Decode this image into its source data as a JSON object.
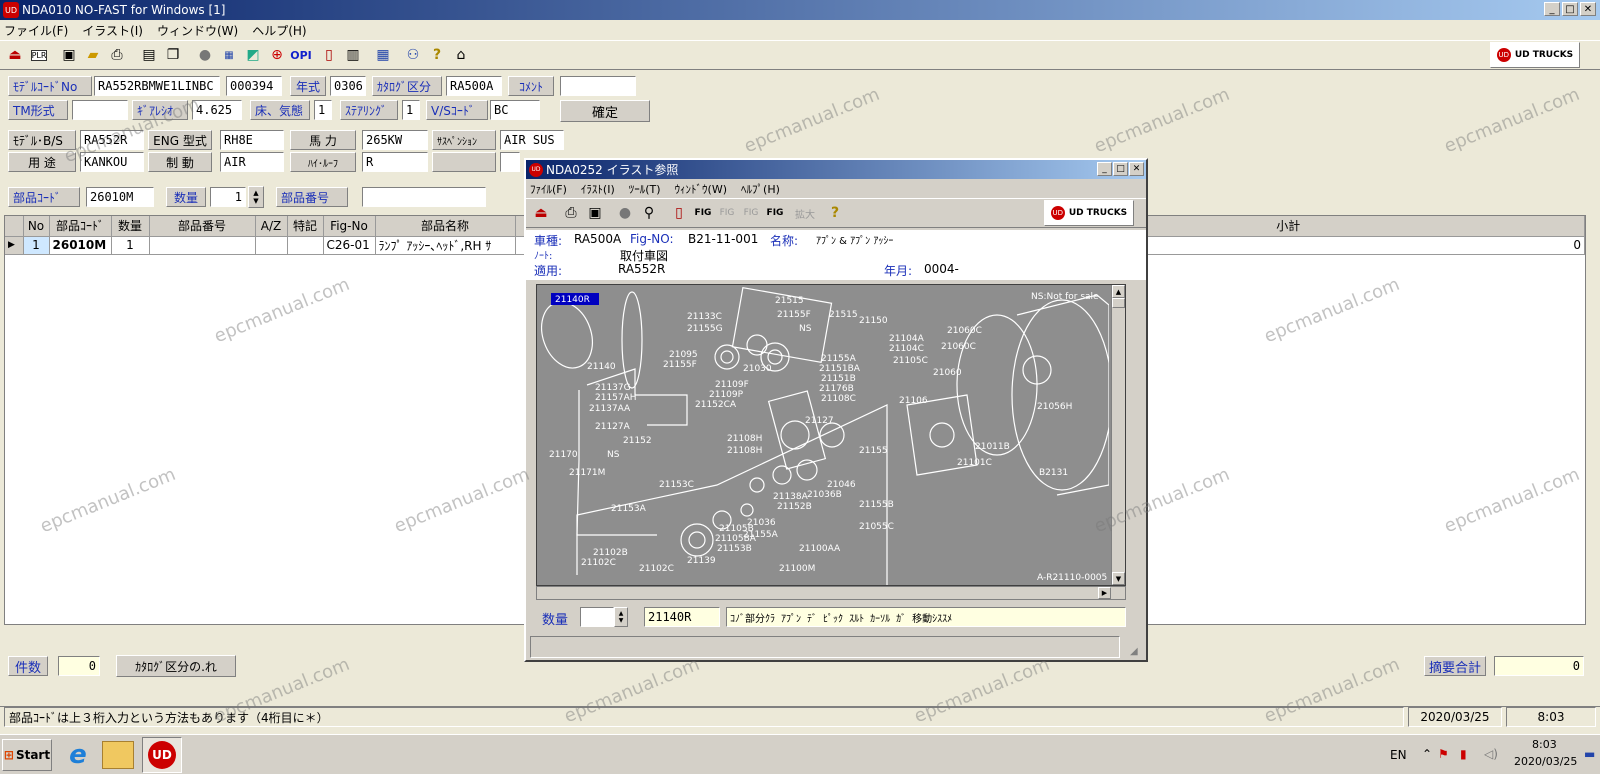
{
  "app": {
    "title": "NDA010 NO-FAST for Windows [1]",
    "menu": [
      "ファイル(F)",
      "イラスト(I)",
      "ウィンドウ(W)",
      "ヘルプ(H)"
    ],
    "brand": "UD TRUCKS"
  },
  "form": {
    "model_code_label": "ﾓﾃﾞﾙｺｰﾄﾞNo",
    "model_code": "RA552RBMWE1LINBC",
    "model_code2": "000394",
    "year_label": "年式",
    "year": "0306",
    "catalog_label": "ｶﾀﾛｸﾞ区分",
    "catalog": "RA500A",
    "comment_label": "ｺﾒﾝﾄ",
    "comment": "",
    "tm_label": "TM形式",
    "tm": "",
    "gear_label": "ｷﾞｱﾚｼｵ",
    "gear": "4.625",
    "floor_label": "床、気態",
    "floor": "1",
    "steer_label": "ｽﾃｱﾘﾝｸﾞ",
    "steer": "1",
    "vs_label": "V/Sｺｰﾄﾞ",
    "vs": "BC",
    "confirm": "確定",
    "model_bs_label": "ﾓﾃﾞﾙ･B/S",
    "model_bs": "RA552R",
    "eng_label": "ENG 型式",
    "eng": "RH8E",
    "power_label": "馬 力",
    "power": "265KW",
    "susp_label": "ｻｽﾍﾟﾝｼｮﾝ",
    "susp": "AIR SUS",
    "use_label": "用 途",
    "use": "KANKOU",
    "brake_label": "制 動",
    "brake": "AIR",
    "hiroof_label": "ﾊｲ･ﾙｰﾌ",
    "hiroof": "R",
    "partcode_label": "部品ｺｰﾄﾞ",
    "partcode": "26010M",
    "qty_label": "数量",
    "qty": "1",
    "partno_label": "部品番号",
    "partno": ""
  },
  "table": {
    "headers": [
      "No",
      "部品ｺｰﾄﾞ",
      "数量",
      "部品番号",
      "A/Z",
      "特記",
      "Fig-No",
      "部品名称"
    ],
    "subtotal_label": "小計",
    "rows": [
      {
        "no": "1",
        "code": "26010M",
        "qty": "1",
        "partno": "",
        "az": "",
        "note": "",
        "fig": "C26-01",
        "name": "ﾗﾝﾌﾟ ｱｯｼｰ､ﾍｯﾄﾞ,RH ｻ",
        "subtotal": "0"
      }
    ]
  },
  "footer": {
    "count_label": "件数",
    "count": "0",
    "catalog_btn": "ｶﾀﾛｸﾞ区分の.れ",
    "sum_label": "摘要合計",
    "sum": "0"
  },
  "status": {
    "message": "部品ｺｰﾄﾞは上３桁入力という方法もあります（4桁目に＊）",
    "date": "2020/03/25",
    "time": "8:03"
  },
  "dialog": {
    "title": "NDA0252 イラスト参照",
    "menu": [
      "ﾌｧｲﾙ(F)",
      "ｲﾗｽﾄ(I)",
      "ﾂｰﾙ(T)",
      "ｳｨﾝﾄﾞｳ(W)",
      "ﾍﾙﾌﾟ(H)"
    ],
    "vehicle_label": "車種:",
    "vehicle": "RA500A",
    "fig_label": "Fig-NO:",
    "fig": "B21-11-001",
    "name_label": "名称:",
    "name": "ｱﾌﾟﾝ & ｱﾌﾟﾝ ｱｯｼｰ",
    "note_label": "ﾉｰﾄ:",
    "note": "取付車図",
    "apply_label": "適用:",
    "apply": "RA552R",
    "date_label": "年月:",
    "date": "0004-",
    "ns_note": "NS:Not for sale",
    "ref": "A-R21110-0005",
    "selected": "21140R",
    "qty_label": "数量",
    "qty": "",
    "part": "21140R",
    "desc": "ｺﾉﾞ部分ｸﾗ ｱﾌﾟﾝ ﾃﾞ ﾋﾟｯｸ ｽﾙﾄ ｶｰｿﾙ ｶﾞ 移動ｼｽｽﾒ",
    "parts": [
      "21515",
      "21515",
      "21150",
      "21133C",
      "21155F",
      "21155G",
      "NS",
      "21140",
      "21095",
      "21155F",
      "21030",
      "21155A",
      "21151BA",
      "21151B",
      "21176B",
      "21108C",
      "21104A",
      "21104C",
      "21105C",
      "21060C",
      "21060C",
      "21060",
      "21137G",
      "21157AH",
      "21137AA",
      "21109F",
      "21109P",
      "21152CA",
      "21106",
      "21127A",
      "21152",
      "21127",
      "21170",
      "NS",
      "21108H",
      "21108H",
      "21155",
      "21056H",
      "21011B",
      "21101C",
      "B2131",
      "21171M",
      "21153C",
      "21046",
      "21036B",
      "21153A",
      "21138A",
      "21152B",
      "21155B",
      "21036",
      "21055C",
      "21105BA",
      "21105B",
      "21155A",
      "21153B",
      "21102B",
      "21102C",
      "21139",
      "21102C",
      "21100AA",
      "21100M"
    ]
  },
  "taskbar": {
    "start": "Start",
    "lang": "EN",
    "time": "8:03",
    "date": "2020/03/25"
  },
  "watermark": "epcmanual.com",
  "colors": {
    "titlebar": "#0a246a",
    "titlebar2": "#a6caf0",
    "label_blue": "#1a2fb8",
    "field_yellow": "#ffffe1",
    "drawing_bg": "#8e8e8e"
  }
}
